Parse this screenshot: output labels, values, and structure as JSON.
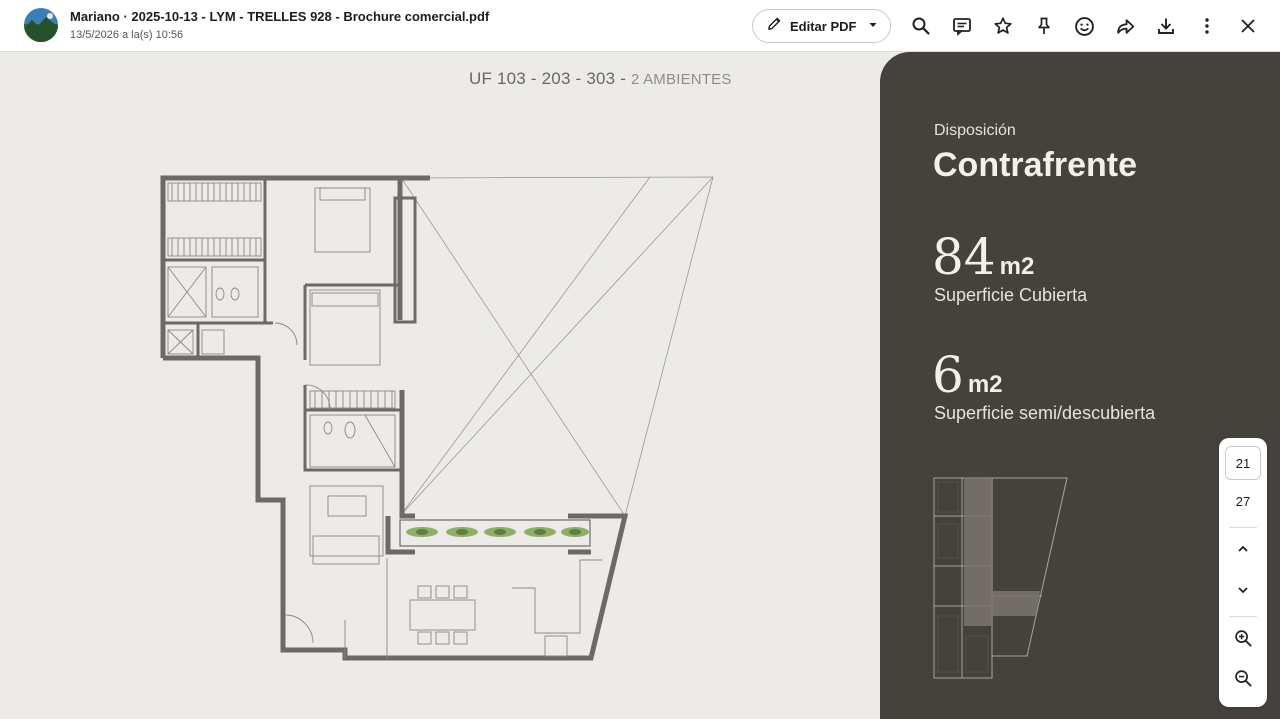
{
  "header": {
    "title": "Mariano · 2025-10-13 - LYM - TRELLES 928 - Brochure comercial.pdf",
    "date": "13/5/2026 a la(s) 10:56",
    "edit_label": "Editar PDF",
    "icons": [
      "search-icon",
      "comment-icon",
      "star-icon",
      "pin-icon",
      "emoji-icon",
      "share-icon",
      "download-icon",
      "more-icon",
      "close-icon"
    ]
  },
  "document": {
    "heading_main": "UF 103 - 203 - 303 -",
    "heading_sub": "2 AMBIENTES",
    "disposition_label": "Disposición",
    "disposition_value": "Contrafrente",
    "covered_value": "84",
    "covered_unit": "m2",
    "covered_label": "Superficie Cubierta",
    "semi_value": "6",
    "semi_unit": "m2",
    "semi_label": "Superficie semi/descubierta"
  },
  "pager": {
    "current": "21",
    "total": "27"
  },
  "colors": {
    "page_bg": "#ecebe7",
    "panel_bg": "#45413d",
    "wall": "#6d6a66"
  }
}
